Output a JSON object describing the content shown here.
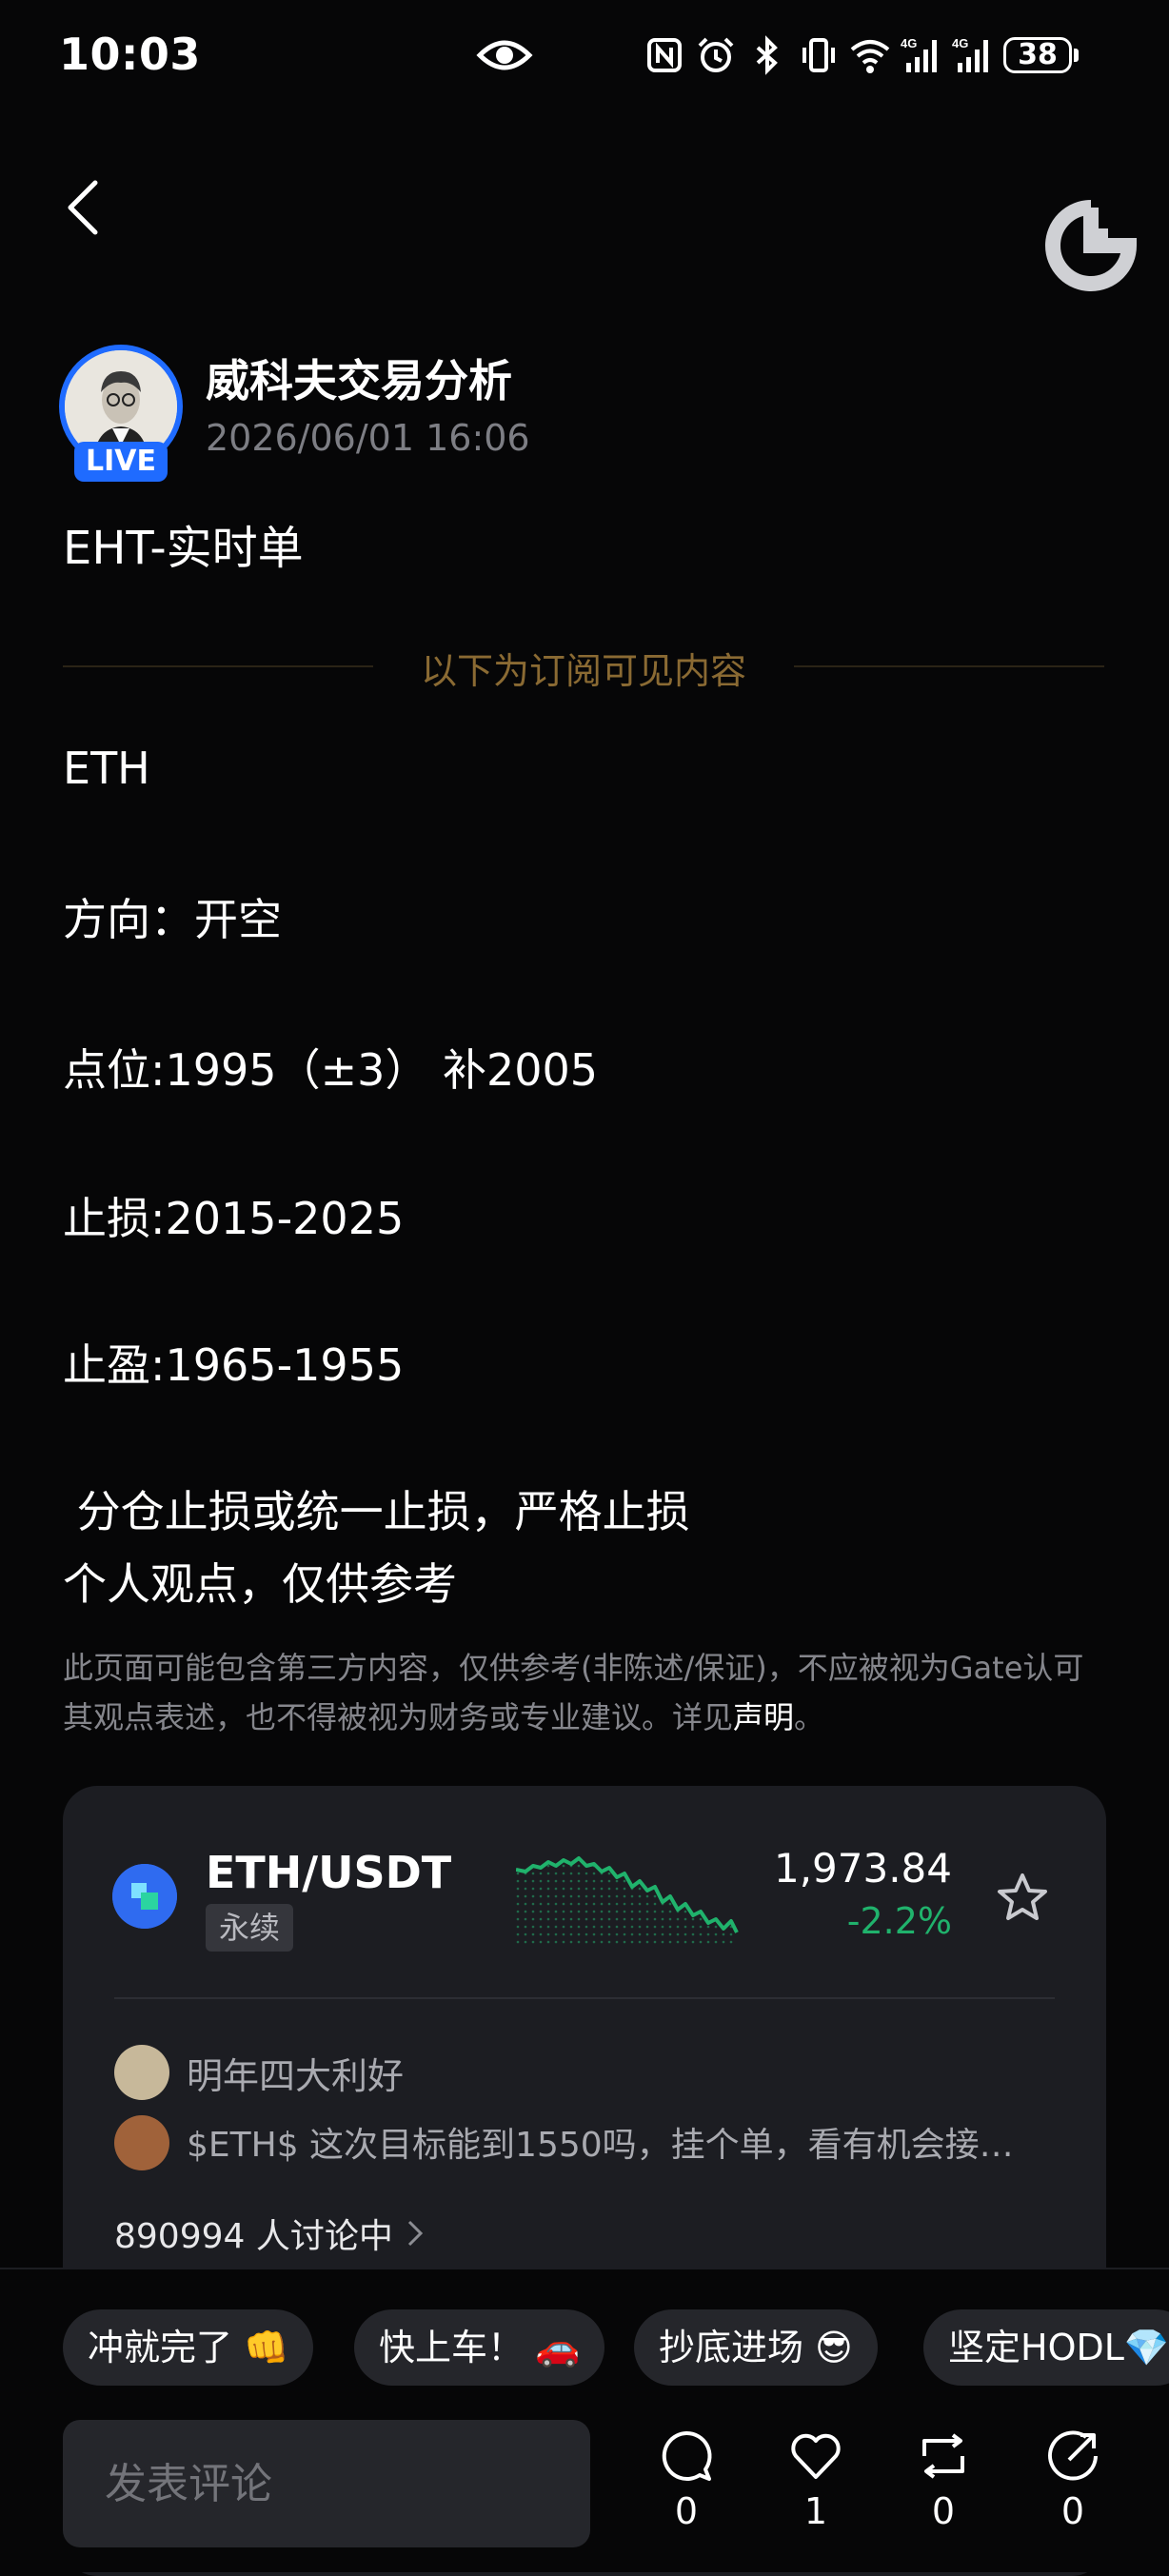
{
  "status_bar": {
    "time": "10:03",
    "battery": "38"
  },
  "author": {
    "name": "威科夫交易分析",
    "time": "2026/06/01 16:06",
    "badge": "LIVE"
  },
  "post": {
    "title": "EHT-实时单",
    "divider_text": "以下为订阅可见内容",
    "lines": [
      "ETH",
      "方向：开空",
      "点位:1995（±3） 补2005",
      "止损:2015-2025",
      "止盈:1965-1955",
      " 分仓止损或统一止损，严格止损",
      "个人观点，仅供参考"
    ]
  },
  "disclaimer": {
    "text": "此页面可能包含第三方内容，仅供参考(非陈述/保证)，不应被视为Gate认可其观点表述，也不得被视为财务或专业建议。详见",
    "link": "声明",
    "end": "。"
  },
  "market_card": {
    "pair": "ETH/USDT",
    "tag": "永续",
    "price": "1,973.84",
    "change": "-2.2%",
    "colors": {
      "down": "#20b26c"
    },
    "comments": [
      {
        "text": "明年四大利好"
      },
      {
        "text": "$ETH$  这次目标能到1550吗，挂个单，看有机会接…"
      }
    ],
    "discussion": "890994 人讨论中"
  },
  "reactions": [
    "冲就完了 👊",
    "快上车！ 🚗",
    "抄底进场 😎",
    "坚定HODL💎"
  ],
  "comment_input": {
    "placeholder": "发表评论"
  },
  "actions": [
    {
      "icon": "comment-icon",
      "count": "0"
    },
    {
      "icon": "heart-icon",
      "count": "1"
    },
    {
      "icon": "repost-icon",
      "count": "0"
    },
    {
      "icon": "share-icon",
      "count": "0"
    }
  ]
}
